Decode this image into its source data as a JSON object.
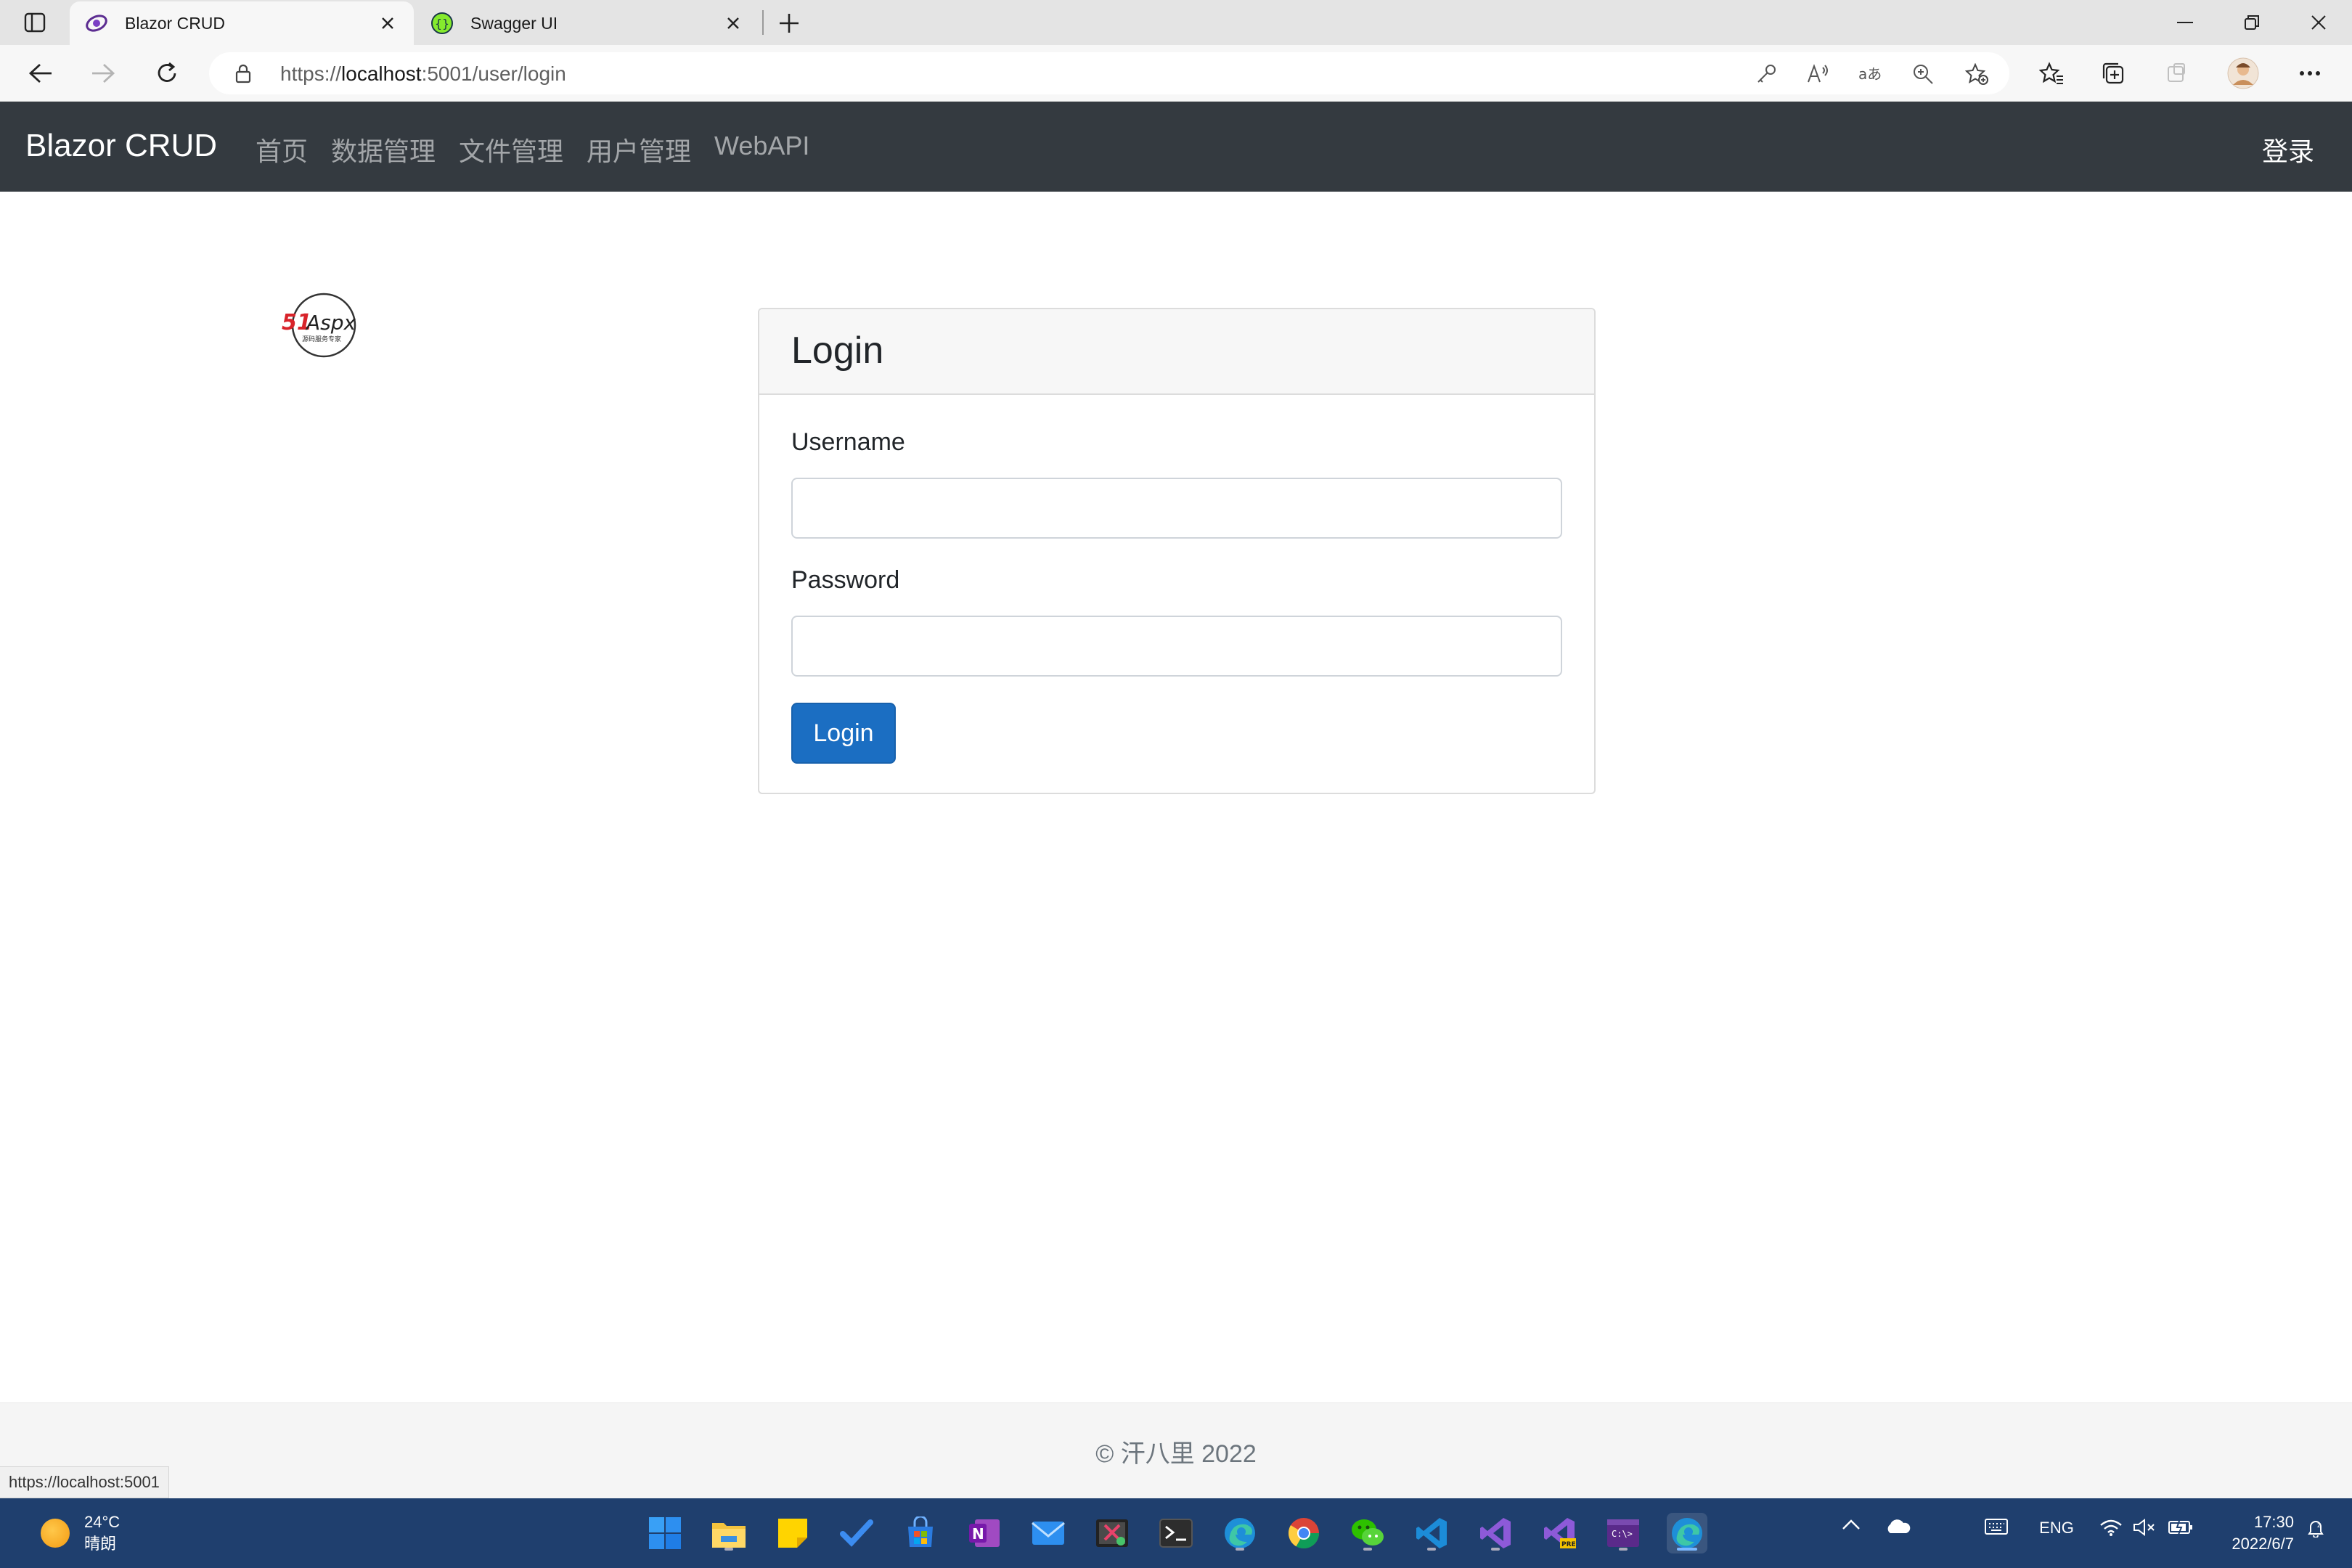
{
  "browser": {
    "tabs": [
      {
        "title": "Blazor CRUD",
        "active": true,
        "icon": "blazor-icon"
      },
      {
        "title": "Swagger UI",
        "active": false,
        "icon": "swagger-icon"
      }
    ],
    "url_scheme": "https://",
    "url_host": "localhost",
    "url_rest": ":5001/user/login"
  },
  "navbar": {
    "brand": "Blazor CRUD",
    "links": [
      "首页",
      "数据管理",
      "文件管理",
      "用户管理",
      "WebAPI"
    ],
    "login": "登录"
  },
  "logo": {
    "text": "51Aspx",
    "subtext": "源码服务专家"
  },
  "login_card": {
    "title": "Login",
    "username_label": "Username",
    "username_value": "",
    "password_label": "Password",
    "password_value": "",
    "submit_label": "Login"
  },
  "footer": {
    "text": "© 汗八里 2022"
  },
  "status_bar": {
    "url": "https://localhost:5001"
  },
  "taskbar": {
    "weather_temp": "24°C",
    "weather_desc": "晴朗",
    "language": "ENG",
    "time": "17:30",
    "date": "2022/6/7"
  },
  "colors": {
    "navbar_bg": "#343a40",
    "primary_button": "#1b6ec2",
    "taskbar_bg": "#1f3f6e"
  }
}
